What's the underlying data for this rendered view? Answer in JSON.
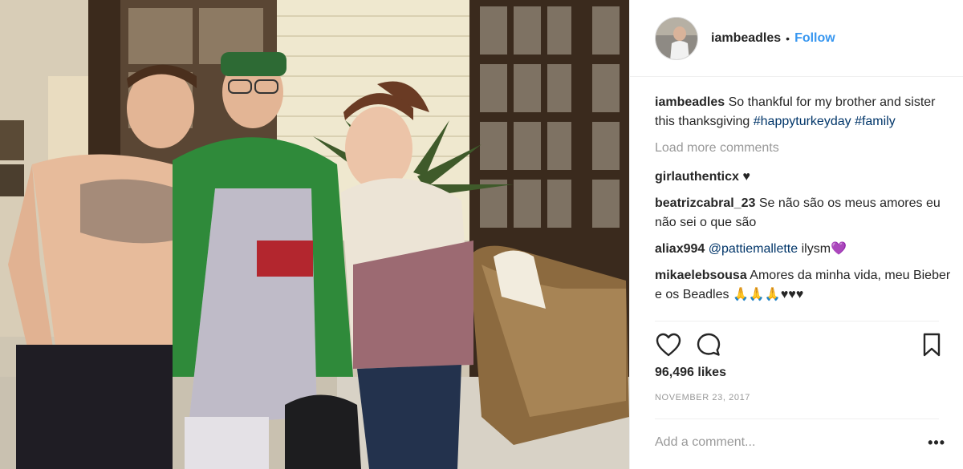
{
  "post": {
    "photo_alt": "Three people standing on a porch",
    "author": "iambeadles",
    "follow_label": "Follow",
    "separator": "•"
  },
  "caption": {
    "username": "iambeadles",
    "text": "So thankful for my brother and sister this thanksgiving",
    "hashtags": [
      "#happyturkeyday",
      "#family"
    ]
  },
  "load_more_label": "Load more comments",
  "comments": [
    {
      "username": "girlauthenticx",
      "text": "♥"
    },
    {
      "username": "beatrizcabral_23",
      "text": "Se não são os meus amores eu não sei o que são"
    },
    {
      "username": "aliax994",
      "mention": "@pattiemallette",
      "text": "ilysm💜"
    },
    {
      "username": "mikaelebsousa",
      "text": "Amores da minha vida, meu Bieber e os Beadles 🙏🙏🙏♥♥♥"
    }
  ],
  "actions": {
    "like_icon": "heart-icon",
    "comment_icon": "comment-icon",
    "save_icon": "bookmark-icon"
  },
  "likes_text": "96,496 likes",
  "date_text": "NOVEMBER 23, 2017",
  "add_comment": {
    "placeholder": "Add a comment...",
    "more_label": "•••"
  },
  "colors": {
    "link": "#003569",
    "follow": "#3897f0",
    "muted": "#999999",
    "text": "#262626"
  }
}
